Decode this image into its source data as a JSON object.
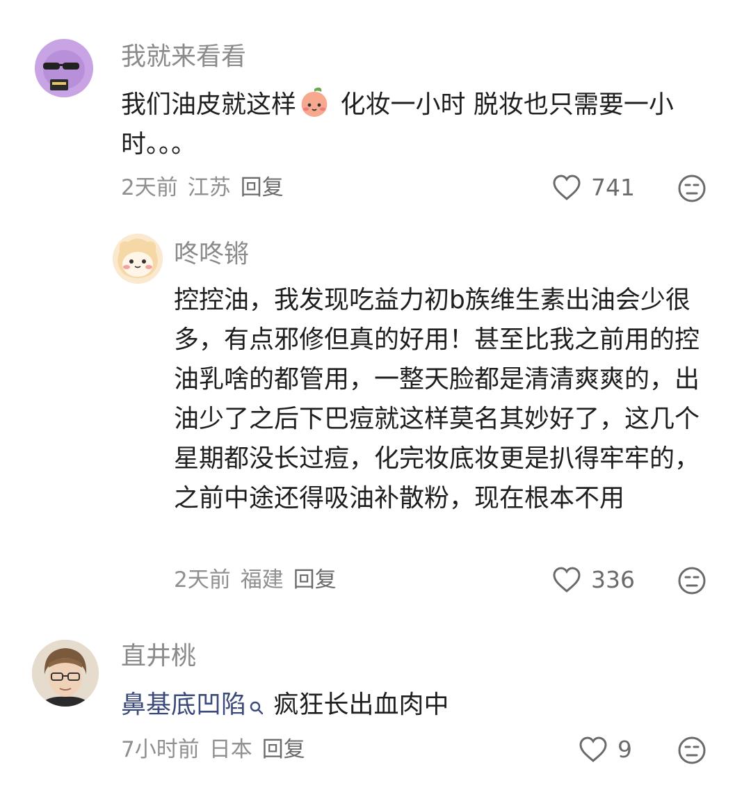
{
  "comments": [
    {
      "username": "我就来看看",
      "text_before_emoji": "我们油皮就这样",
      "text_after_emoji": " 化妆一小时 脱妆也只需要一小时。。。",
      "time": "2天前",
      "location": "江苏",
      "reply_label": "回复",
      "likes": "741",
      "avatar_color": "#c9a4e4"
    },
    {
      "username": "咚咚锵",
      "text": "控控油，我发现吃益力初b族维生素出油会少很多，有点邪修但真的好用！甚至比我之前用的控油乳啥的都管用，一整天脸都是清清爽爽的，出油少了之后下巴痘就这样莫名其妙好了，这几个星期都没长过痘，化完妆底妆更是扒得牢牢的，之前中途还得吸油补散粉，现在根本不用",
      "time": "2天前",
      "location": "福建",
      "reply_label": "回复",
      "likes": "336",
      "avatar_color": "#f6e3c5"
    },
    {
      "username": "直井桃",
      "mention": "鼻基底凹陷",
      "text": " 疯狂长出血肉中",
      "time": "7小时前",
      "location": "日本",
      "reply_label": "回复",
      "likes": "9",
      "avatar_color": "#d9c2a6"
    }
  ],
  "icons": {
    "like": "heart-outline-icon",
    "dislike": "meh-face-icon",
    "emoji": "peach-emoji-icon",
    "search": "search-icon"
  },
  "colors": {
    "username": "#8a8a8a",
    "text": "#1e1e1e",
    "mention": "#3b4a7a"
  }
}
